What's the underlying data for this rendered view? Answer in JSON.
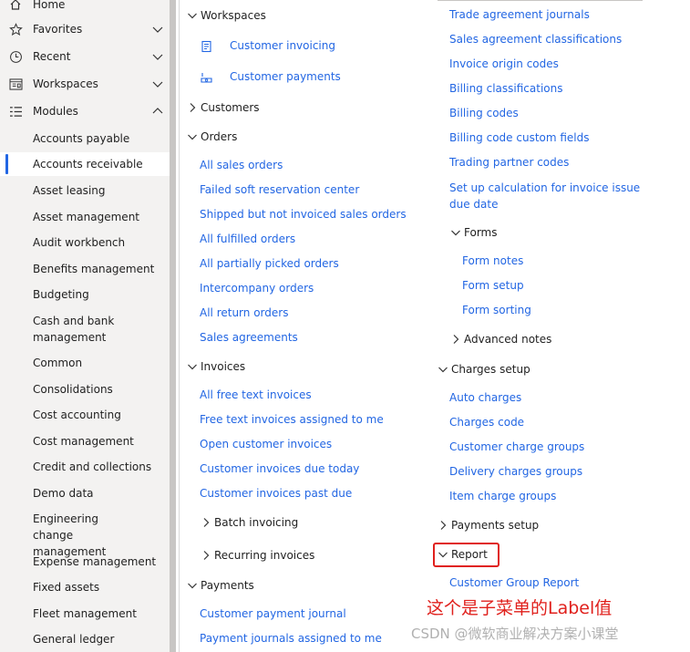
{
  "nav": {
    "home": "Home",
    "favorites": "Favorites",
    "recent": "Recent",
    "workspaces": "Workspaces",
    "modules": "Modules",
    "module_items": [
      "Accounts payable",
      "Accounts receivable",
      "Asset leasing",
      "Asset management",
      "Audit workbench",
      "Benefits management",
      "Budgeting",
      "Cash and bank management",
      "Common",
      "Consolidations",
      "Cost accounting",
      "Cost management",
      "Credit and collections",
      "Demo data",
      "Engineering change management",
      "Expense management",
      "Fixed assets",
      "Fleet management",
      "General ledger"
    ]
  },
  "col1": {
    "workspaces_header": "Workspaces",
    "workspace_links": [
      "Customer invoicing",
      "Customer payments"
    ],
    "customers_header": "Customers",
    "orders_header": "Orders",
    "orders_links": [
      "All sales orders",
      "Failed soft reservation center",
      "Shipped but not invoiced sales orders",
      "All fulfilled orders",
      "All partially picked orders",
      "Intercompany orders",
      "All return orders",
      "Sales agreements"
    ],
    "invoices_header": "Invoices",
    "invoices_links": [
      "All free text invoices",
      "Free text invoices assigned to me",
      "Open customer invoices",
      "Customer invoices due today",
      "Customer invoices past due"
    ],
    "batch_invoicing": "Batch invoicing",
    "recurring_invoices": "Recurring invoices",
    "payments_header": "Payments",
    "payments_links": [
      "Customer payment journal",
      "Payment journals assigned to me"
    ]
  },
  "col2": {
    "top_links": [
      "Trade agreement journals",
      "Sales agreement classifications",
      "Invoice origin codes",
      "Billing classifications",
      "Billing codes",
      "Billing code custom fields",
      "Trading partner codes",
      "Set up calculation for invoice issue due date"
    ],
    "forms_header": "Forms",
    "forms_links": [
      "Form notes",
      "Form setup",
      "Form sorting"
    ],
    "advanced_notes": "Advanced notes",
    "charges_header": "Charges setup",
    "charges_links": [
      "Auto charges",
      "Charges code",
      "Customer charge groups",
      "Delivery charges groups",
      "Item charge groups"
    ],
    "payments_setup": "Payments setup",
    "report_header": "Report",
    "report_links": [
      "Customer Group Report"
    ]
  },
  "annotation": "这个是子菜单的Label值",
  "watermark": "CSDN @微软商业解决方案小课堂",
  "colors": {
    "link": "#2266e3",
    "accent": "#2266e3",
    "annotation": "#e0201c",
    "nav_bg": "#f3f2f1"
  }
}
